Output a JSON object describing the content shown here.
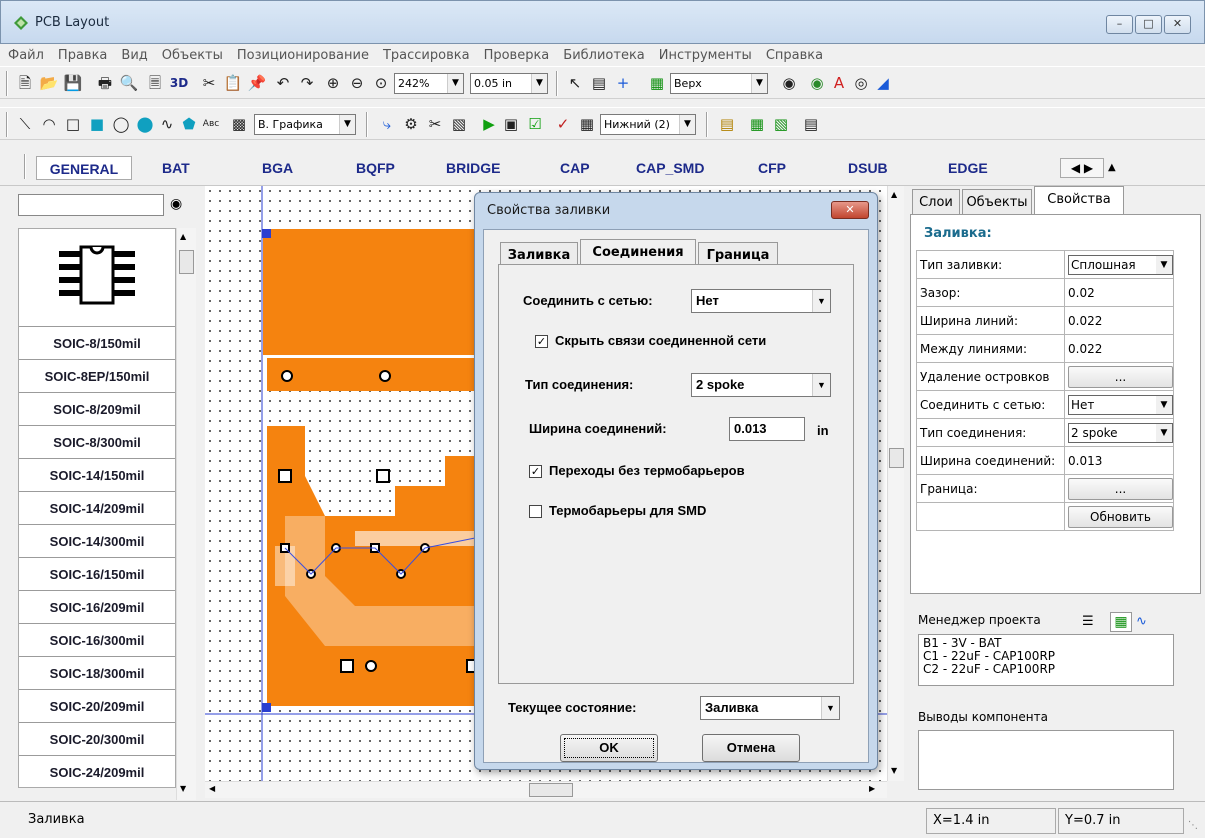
{
  "window": {
    "title": "PCB Layout"
  },
  "menu": [
    "Файл",
    "Правка",
    "Вид",
    "Объекты",
    "Позиционирование",
    "Трассировка",
    "Проверка",
    "Библиотека",
    "Инструменты",
    "Справка"
  ],
  "toolbar1": {
    "zoom": "242%",
    "grid": "0.05 in",
    "layer": "Верх",
    "view3d": "3D"
  },
  "toolbar2": {
    "graphics": "В. Графика",
    "bottom_layer": "Нижний (2)",
    "text_tool": "Aвc"
  },
  "library_tabs": [
    "GENERAL",
    "BAT",
    "BGA",
    "BQFP",
    "BRIDGE",
    "CAP",
    "CAP_SMD",
    "CFP",
    "DSUB",
    "EDGE"
  ],
  "components": [
    "SOIC-8/150mil",
    "SOIC-8EP/150mil",
    "SOIC-8/209mil",
    "SOIC-8/300mil",
    "SOIC-14/150mil",
    "SOIC-14/209mil",
    "SOIC-14/300mil",
    "SOIC-16/150mil",
    "SOIC-16/209mil",
    "SOIC-16/300mil",
    "SOIC-18/300mil",
    "SOIC-20/209mil",
    "SOIC-20/300mil",
    "SOIC-24/209mil"
  ],
  "right_tabs": [
    "Слои",
    "Объекты",
    "Свойства"
  ],
  "props": {
    "title": "Заливка:",
    "rows": [
      {
        "label": "Тип заливки:",
        "value": "Сплошная"
      },
      {
        "label": "Зазор:",
        "value": "0.02"
      },
      {
        "label": "Ширина линий:",
        "value": "0.022"
      },
      {
        "label": "Между линиями:",
        "value": "0.022"
      },
      {
        "label": "Удаление островков",
        "value": "..."
      },
      {
        "label": "Соединить с сетью:",
        "value": "Нет"
      },
      {
        "label": "Тип соединения:",
        "value": "2 spoke"
      },
      {
        "label": "Ширина соединений:",
        "value": "0.013"
      },
      {
        "label": "Граница:",
        "value": "..."
      }
    ],
    "update_button": "Обновить"
  },
  "project": {
    "title": "Менеджер проекта",
    "items": [
      "B1 - 3V - BAT",
      "C1 - 22uF - CAP100RP",
      "C2 - 22uF - CAP100RP"
    ],
    "pins_title": "Выводы компонента"
  },
  "dialog": {
    "title": "Свойства заливки",
    "tabs": [
      "Заливка",
      "Соединения",
      "Граница"
    ],
    "connect_label": "Соединить с сетью:",
    "connect_value": "Нет",
    "hide_links": "Скрыть связи соединенной сети",
    "conn_type_label": "Тип соединения:",
    "conn_type_value": "2 spoke",
    "width_label": "Ширина соединений:",
    "width_value": "0.013",
    "width_unit": "in",
    "vias": "Переходы без термобарьеров",
    "smd": "Термобарьеры для SMD",
    "state_label": "Текущее состояние:",
    "state_value": "Заливка",
    "ok": "OK",
    "cancel": "Отмена"
  },
  "status": {
    "text": "Заливка",
    "x": "X=1.4 in",
    "y": "Y=0.7 in"
  },
  "colors": {
    "copper": "#f5830f",
    "accent": "#1d2a8a"
  }
}
